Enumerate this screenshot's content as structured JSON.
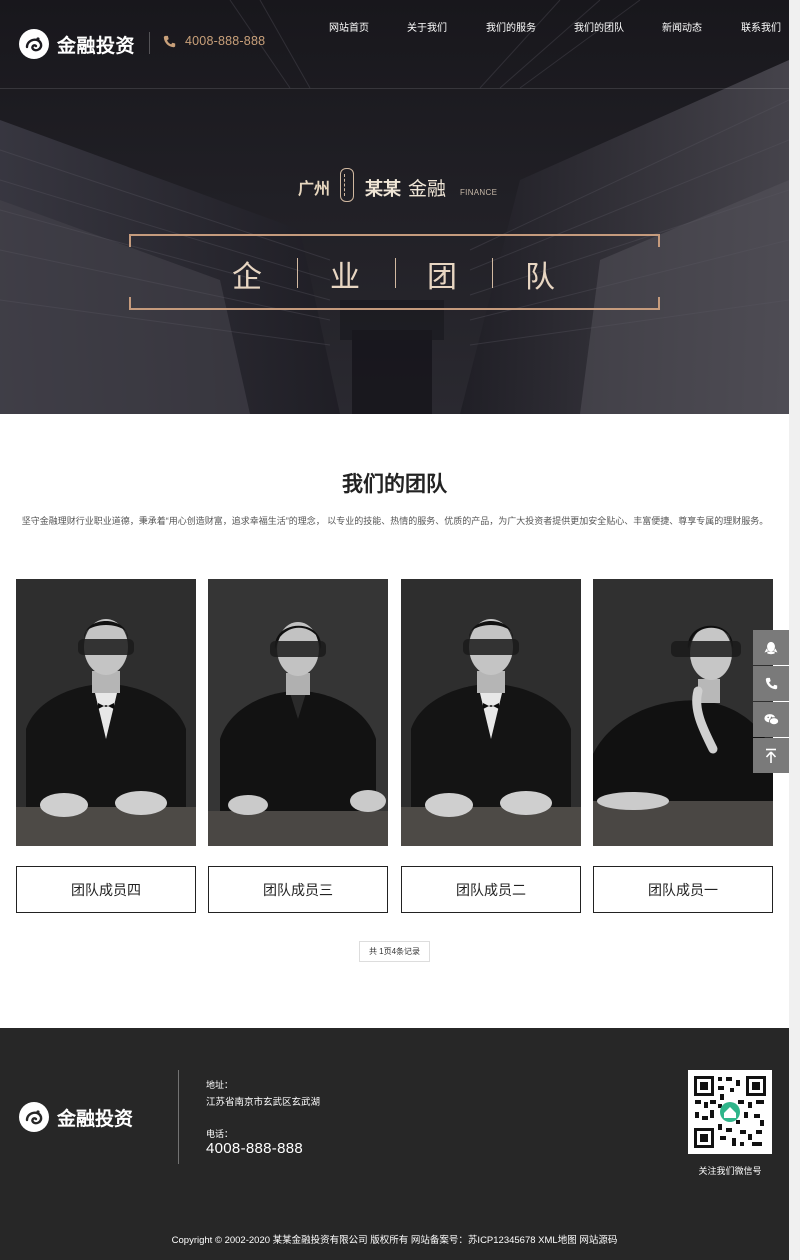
{
  "header": {
    "logo_text": "金融投资",
    "phone": "4008-888-888",
    "nav": [
      {
        "label": "网站首页"
      },
      {
        "label": "关于我们"
      },
      {
        "label": "我们的服务"
      },
      {
        "label": "我们的团队"
      },
      {
        "label": "新闻动态"
      },
      {
        "label": "联系我们"
      }
    ]
  },
  "hero": {
    "city": "广州",
    "brand_bold": "某某",
    "brand_light": "金融",
    "brand_en": "FINANCE",
    "title_chars": [
      "企",
      "业",
      "团",
      "队"
    ]
  },
  "section": {
    "title": "我们的团队",
    "description": "坚守金融理财行业职业道德，秉承着“用心创造财富，追求幸福生活”的理念， 以专业的技能、热情的服务、优质的产品，为广大投资者提供更加安全贴心、丰富便捷、尊享专属的理财服务。"
  },
  "team": [
    {
      "name": "团队成员四",
      "gender": "male"
    },
    {
      "name": "团队成员三",
      "gender": "female"
    },
    {
      "name": "团队成员二",
      "gender": "male"
    },
    {
      "name": "团队成员一",
      "gender": "female"
    }
  ],
  "pagination": {
    "text": "共 1页4条记录"
  },
  "side_toolbar": [
    {
      "icon": "qq-icon"
    },
    {
      "icon": "phone-icon"
    },
    {
      "icon": "wechat-icon"
    },
    {
      "icon": "back-to-top-icon"
    }
  ],
  "footer": {
    "logo_text": "金融投资",
    "address_label": "地址：",
    "address": "江苏省南京市玄武区玄武湖",
    "phone_label": "电话：",
    "phone": "4008-888-888",
    "qr_caption": "关注我们微信号",
    "copyright": "Copyright © 2002-2020 某某金融投资有限公司 版权所有 网站备案号：苏ICP12345678 XML地图 网站源码"
  },
  "colors": {
    "accent_gold": "#c59b7d",
    "hero_dark": "#1b1a20",
    "footer_bg": "#272727"
  }
}
